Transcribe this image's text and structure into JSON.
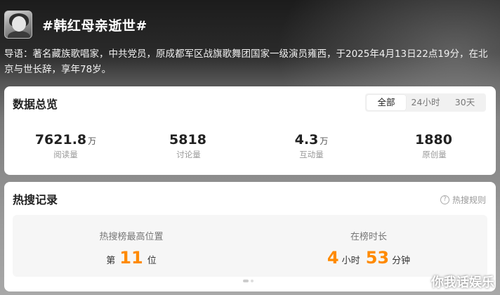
{
  "topic": {
    "title": "#韩红母亲逝世#",
    "intro": "导语：著名藏族歌唱家，中共党员，原成都军区战旗歌舞团国家一级演员雍西，于2025年4月13日22点19分，在北京与世长辞，享年78岁。"
  },
  "overview": {
    "title": "数据总览",
    "tabs": [
      "全部",
      "24小时",
      "30天"
    ],
    "active_tab": "全部",
    "stats": [
      {
        "value": "7621.8",
        "unit": "万",
        "label": "阅读量"
      },
      {
        "value": "5818",
        "unit": "",
        "label": "讨论量"
      },
      {
        "value": "4.3",
        "unit": "万",
        "label": "互动量"
      },
      {
        "value": "1880",
        "unit": "",
        "label": "原创量"
      }
    ]
  },
  "hot_search": {
    "title": "热搜记录",
    "rules_label": "热搜规则",
    "peak": {
      "label": "热搜榜最高位置",
      "prefix": "第",
      "value": "11",
      "suffix": "位"
    },
    "duration": {
      "label": "在榜时长",
      "hours": "4",
      "hours_unit": "小时",
      "minutes": "53",
      "minutes_unit": "分钟"
    }
  },
  "watermark": "你我话娱乐",
  "colors": {
    "accent": "#ff8a00"
  }
}
